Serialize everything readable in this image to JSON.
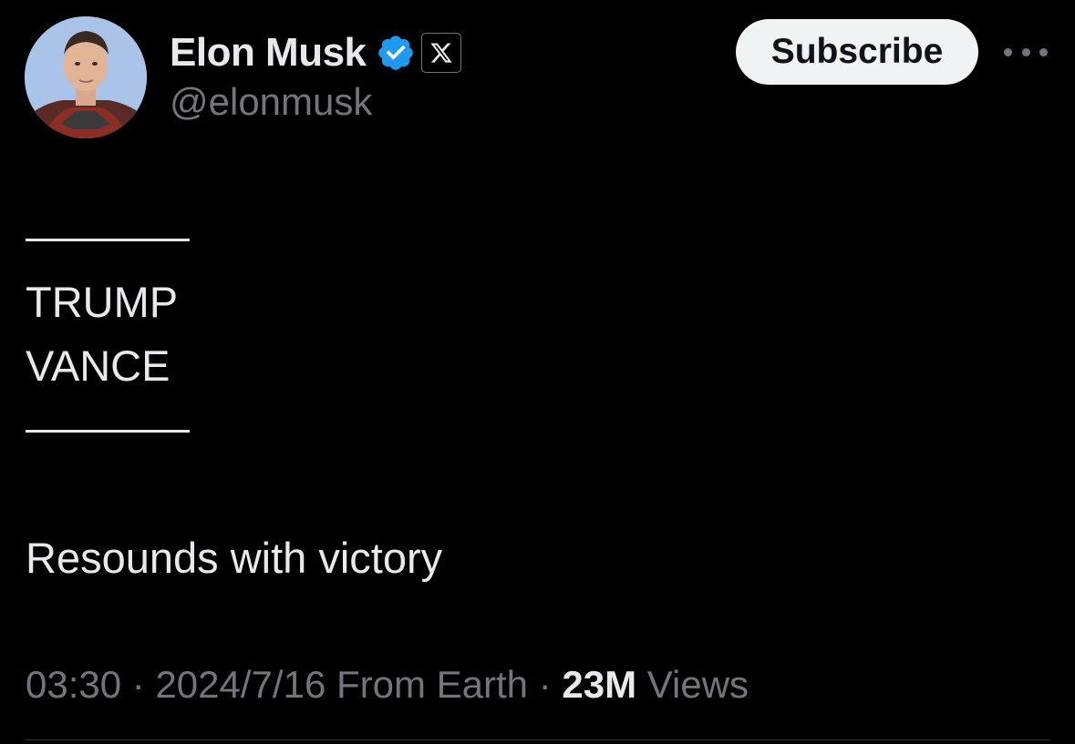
{
  "author": {
    "display_name": "Elon Musk",
    "handle": "@elonmusk",
    "avatar_icon": "profile-photo",
    "verified_icon": "verified-badge-icon",
    "affiliation_icon": "x-logo-icon",
    "verified_color": "#1d9bf0"
  },
  "actions": {
    "subscribe_label": "Subscribe",
    "more_icon": "more-options-icon"
  },
  "tweet": {
    "rule_top": "———",
    "line1": "TRUMP",
    "line2": "VANCE",
    "rule_bottom": "———",
    "line3": "Resounds with victory"
  },
  "meta": {
    "time": "03:30",
    "date": "2024/7/16",
    "source": "From Earth",
    "views_count": "23M",
    "views_label": "Views",
    "sep": "·"
  },
  "colors": {
    "background": "#000000",
    "primary_text": "#e7e9ea",
    "secondary_text": "#71767b",
    "button_bg": "#eff3f4"
  }
}
